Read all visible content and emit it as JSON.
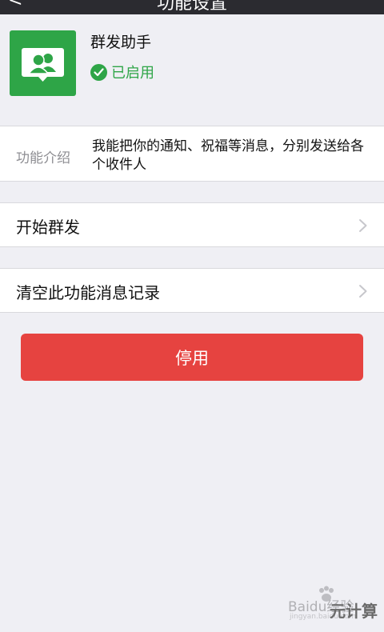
{
  "navbar": {
    "back_label": "<",
    "title": "功能设置"
  },
  "app": {
    "name": "群发助手",
    "status": "已启用",
    "icon": "group-chat-icon"
  },
  "description": {
    "label": "功能介绍",
    "text": "我能把你的通知、祝福等消息，分别发送给各个收件人"
  },
  "actions": [
    {
      "label": "开始群发",
      "icon": "chevron-right-icon"
    },
    {
      "label": "清空此功能消息记录",
      "icon": "chevron-right-icon"
    }
  ],
  "disable_button": {
    "label": "停用"
  },
  "watermark": {
    "brand": "Baidu经验",
    "sub": "jingyan.baidu.com",
    "site": "元计算"
  },
  "colors": {
    "background": "#efeff4",
    "brand_green": "#2ea547",
    "danger_red": "#e64340",
    "navbar": "#2b2b30",
    "secondary_text": "#8e8e93"
  }
}
